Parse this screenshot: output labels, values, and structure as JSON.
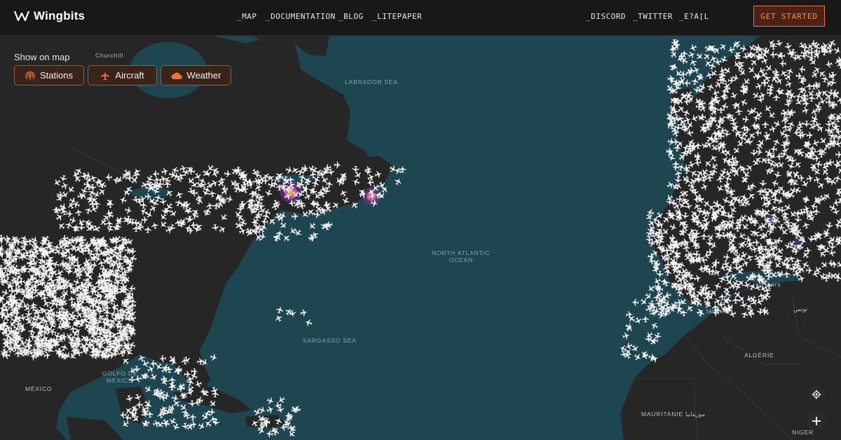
{
  "brand": {
    "name": "Wingbits"
  },
  "nav": {
    "links": [
      "_MAP",
      "_DOCUMENTATION",
      "_BLOG",
      "_LITEPAPER"
    ],
    "social": [
      "_DISCORD",
      "_TWITTER",
      "_E?A[L"
    ],
    "cta_label": "GET STARTED"
  },
  "filters": {
    "title": "Show on map",
    "items": [
      {
        "label": "Stations",
        "icon": "antenna-icon"
      },
      {
        "label": "Aircraft",
        "icon": "airplane-icon"
      },
      {
        "label": "Weather",
        "icon": "cloud-icon"
      }
    ]
  },
  "map": {
    "ocean_labels": [
      "LABRADOR SEA",
      "NORTH ATLANTIC\nOCEAN",
      "SARGASSO SEA",
      "GOLFO DE\nMÉXICO"
    ],
    "land_labels": [
      "Churchill",
      "Chihuahua",
      "MÉXICO",
      "ALGÉRIE",
      "MAURITANIE موريتانيا",
      "NIGER",
      "تونس",
      "lgers",
      "lanca"
    ],
    "controls": [
      {
        "icon": "locate-icon"
      },
      {
        "icon": "zoom-in-icon"
      }
    ]
  },
  "colors": {
    "ocean": "#1d4650",
    "land": "#262626",
    "accent": "#e8763a",
    "aircraft": "#f2f2f2"
  }
}
